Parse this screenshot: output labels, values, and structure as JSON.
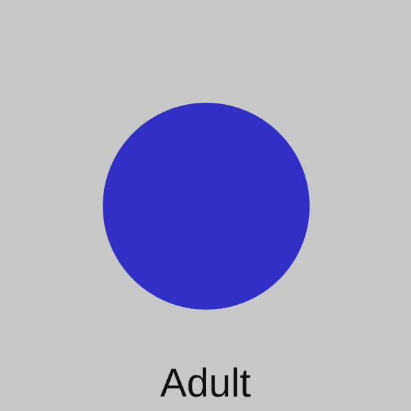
{
  "colors": {
    "background": "#c8c8c8",
    "circle_fill": "#3030c6",
    "text": "#111111"
  },
  "circle": {
    "shape": "circle"
  },
  "caption": {
    "label": "Adult"
  }
}
